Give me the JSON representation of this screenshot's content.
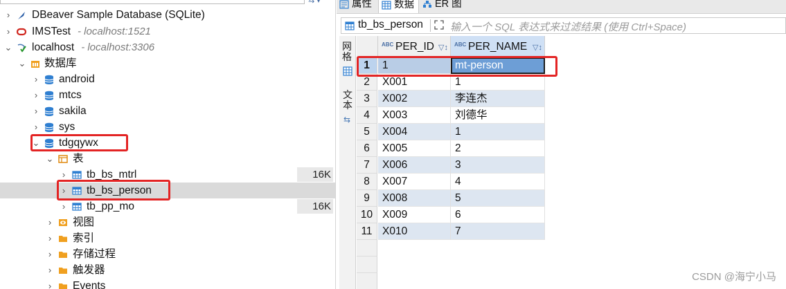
{
  "navigator": {
    "items": [
      {
        "label": "DBeaver Sample Database (SQLite)",
        "host": ""
      },
      {
        "label": "IMSTest",
        "host": "- localhost:1521"
      },
      {
        "label": "localhost",
        "host": "- localhost:3306"
      },
      {
        "label": "数据库"
      },
      {
        "label": "android"
      },
      {
        "label": "mtcs"
      },
      {
        "label": "sakila"
      },
      {
        "label": "sys"
      },
      {
        "label": "tdgqywx"
      },
      {
        "label": "表"
      },
      {
        "label": "tb_bs_mtrl",
        "size": "16K"
      },
      {
        "label": "tb_bs_person"
      },
      {
        "label": "tb_pp_mo",
        "size": "16K"
      },
      {
        "label": "视图"
      },
      {
        "label": "索引"
      },
      {
        "label": "存储过程"
      },
      {
        "label": "触发器"
      },
      {
        "label": "Events"
      }
    ]
  },
  "editor": {
    "tabs": [
      {
        "label": "属性"
      },
      {
        "label": "数据"
      },
      {
        "label": "ER 图"
      }
    ],
    "table_name": "tb_bs_person",
    "filter_placeholder": "输入一个 SQL 表达式来过滤结果 (使用 Ctrl+Space)",
    "side_panel": {
      "grid_label": "网格",
      "text_label": "文本"
    },
    "columns": [
      {
        "type_badge": "ABC",
        "name": "PER_ID"
      },
      {
        "type_badge": "ABC",
        "name": "PER_NAME"
      }
    ],
    "rows": [
      {
        "num": "1",
        "PER_ID": "1",
        "PER_NAME": "mt-person"
      },
      {
        "num": "2",
        "PER_ID": "X001",
        "PER_NAME": "1"
      },
      {
        "num": "3",
        "PER_ID": "X002",
        "PER_NAME": "李连杰"
      },
      {
        "num": "4",
        "PER_ID": "X003",
        "PER_NAME": "刘德华"
      },
      {
        "num": "5",
        "PER_ID": "X004",
        "PER_NAME": "1"
      },
      {
        "num": "6",
        "PER_ID": "X005",
        "PER_NAME": "2"
      },
      {
        "num": "7",
        "PER_ID": "X006",
        "PER_NAME": "3"
      },
      {
        "num": "8",
        "PER_ID": "X007",
        "PER_NAME": "4"
      },
      {
        "num": "9",
        "PER_ID": "X008",
        "PER_NAME": "5"
      },
      {
        "num": "10",
        "PER_ID": "X009",
        "PER_NAME": "6"
      },
      {
        "num": "11",
        "PER_ID": "X010",
        "PER_NAME": "7"
      }
    ]
  },
  "watermark": "CSDN @海宁小马",
  "colors": {
    "highlight_red": "#e32424",
    "selected_row_bg": "#dadada",
    "stripe": "#dde6f1",
    "focus_cell": "#6d9ed6"
  }
}
